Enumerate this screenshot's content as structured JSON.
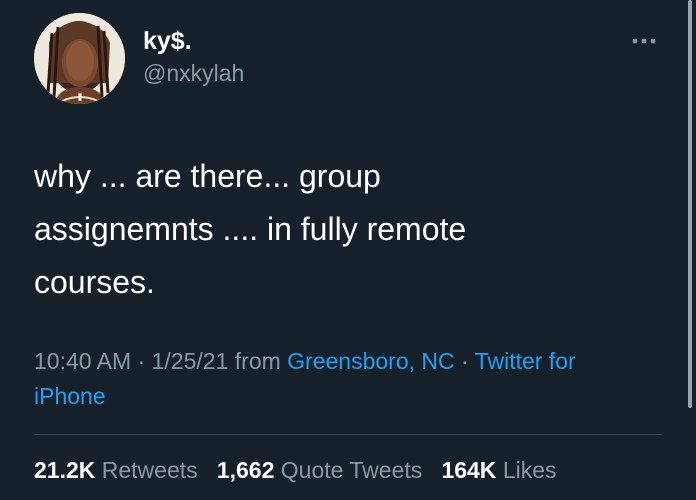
{
  "tweet": {
    "display_name": "ky$.",
    "handle": "@nxkylah",
    "text": "why ... are there... group\nassignemnts .... in fully remote\ncourses.",
    "time": "10:40 AM",
    "date": "1/25/21",
    "from_label": "from",
    "location": "Greensboro, NC",
    "separator": "·",
    "source": "Twitter for iPhone"
  },
  "stats": {
    "retweets_count": "21.2K",
    "retweets_label": "Retweets",
    "quote_count": "1,662",
    "quote_label": "Quote Tweets",
    "likes_count": "164K",
    "likes_label": "Likes"
  },
  "icons": {
    "more": "more-dots-icon",
    "avatar": "profile-avatar"
  },
  "colors": {
    "background": "#15202b",
    "primary_text": "#ffffff",
    "secondary_text": "#8899a6",
    "link": "#1da1f2",
    "divider": "#38444d"
  }
}
